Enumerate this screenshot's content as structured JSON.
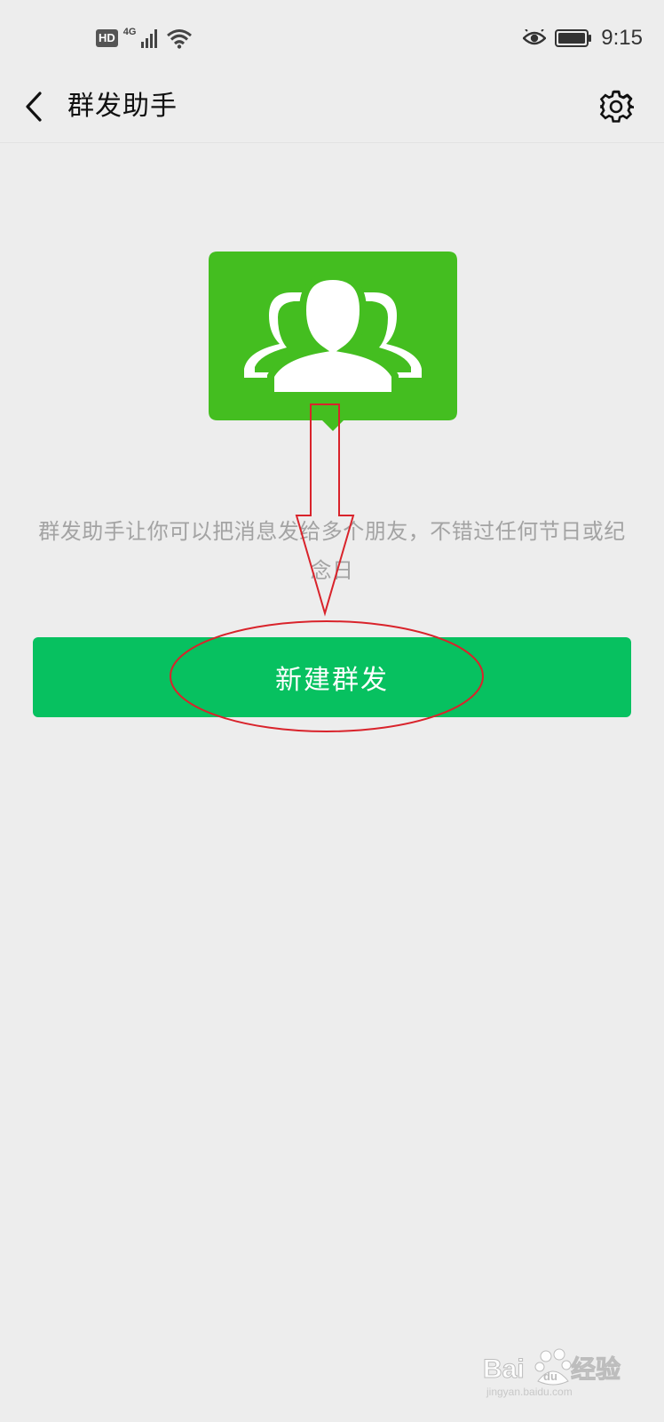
{
  "status_bar": {
    "hd_label": "HD",
    "network_label": "4G",
    "time": "9:15",
    "icons": [
      "signal-icon",
      "wifi-icon",
      "eye-icon",
      "battery-icon"
    ]
  },
  "header": {
    "title": "群发助手",
    "back_icon": "chevron-left-icon",
    "settings_icon": "gear-icon"
  },
  "hero": {
    "icon": "group-chat-icon",
    "color": "#44be20"
  },
  "description": {
    "text": "群发助手让你可以把消息发给多个朋友，不错过任何节日或纪念日"
  },
  "primary_button": {
    "label": "新建群发",
    "color": "#07c160"
  },
  "annotation": {
    "color": "#d9232b",
    "shapes": [
      "arrow-down",
      "ellipse"
    ]
  },
  "watermark": {
    "text": "Bai经验",
    "brand": "du",
    "sub": "jingyan.baidu.com"
  }
}
